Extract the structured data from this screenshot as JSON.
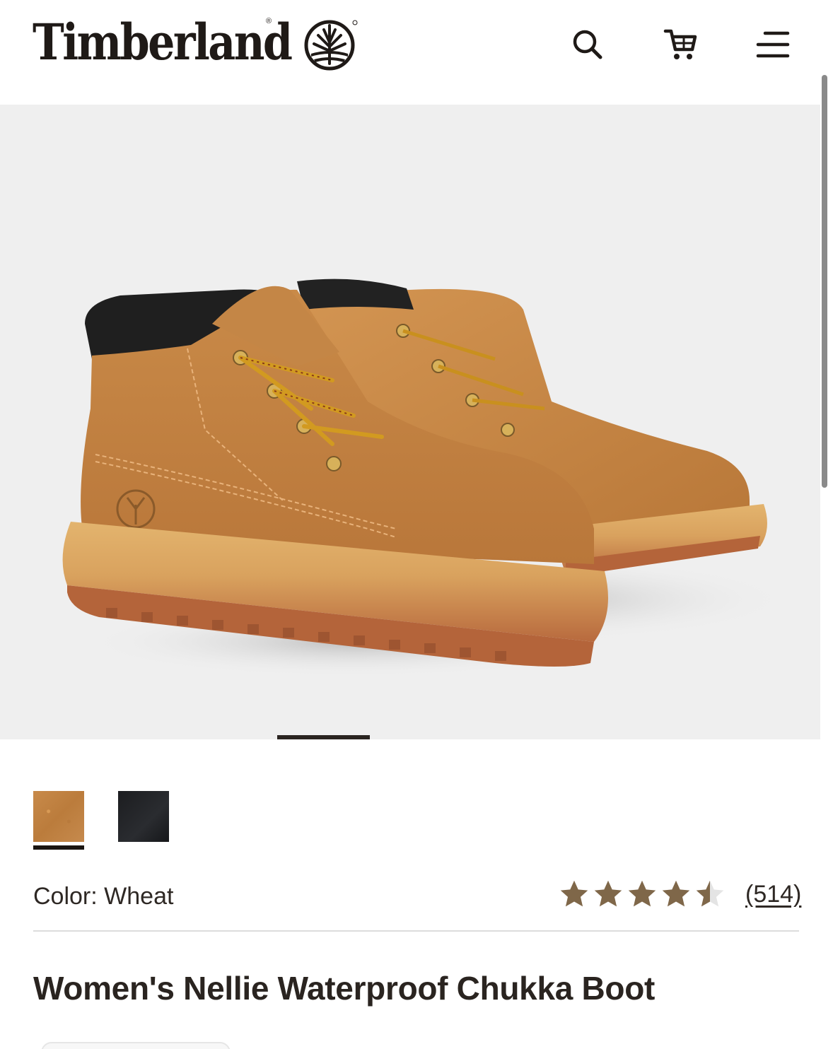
{
  "header": {
    "brand": "Timberland",
    "brand_reg": "®",
    "icons": [
      "search-icon",
      "cart-icon",
      "menu-icon"
    ]
  },
  "gallery": {
    "image": "boot-product-image",
    "active_slide": 1
  },
  "swatches": [
    {
      "name": "Wheat",
      "color": "#c2823f",
      "selected": true
    },
    {
      "name": "Black",
      "color": "#1f2024",
      "selected": false
    }
  ],
  "color": {
    "label": "Color:",
    "value": "Wheat"
  },
  "rating": {
    "stars": 4.5,
    "max": 5,
    "review_count": "(514)",
    "star_color": "#7f6749"
  },
  "product": {
    "title": "Women's Nellie Waterproof Chukka Boot"
  },
  "colors": {
    "text": "#2a2420",
    "hero_bg": "#efefef"
  }
}
